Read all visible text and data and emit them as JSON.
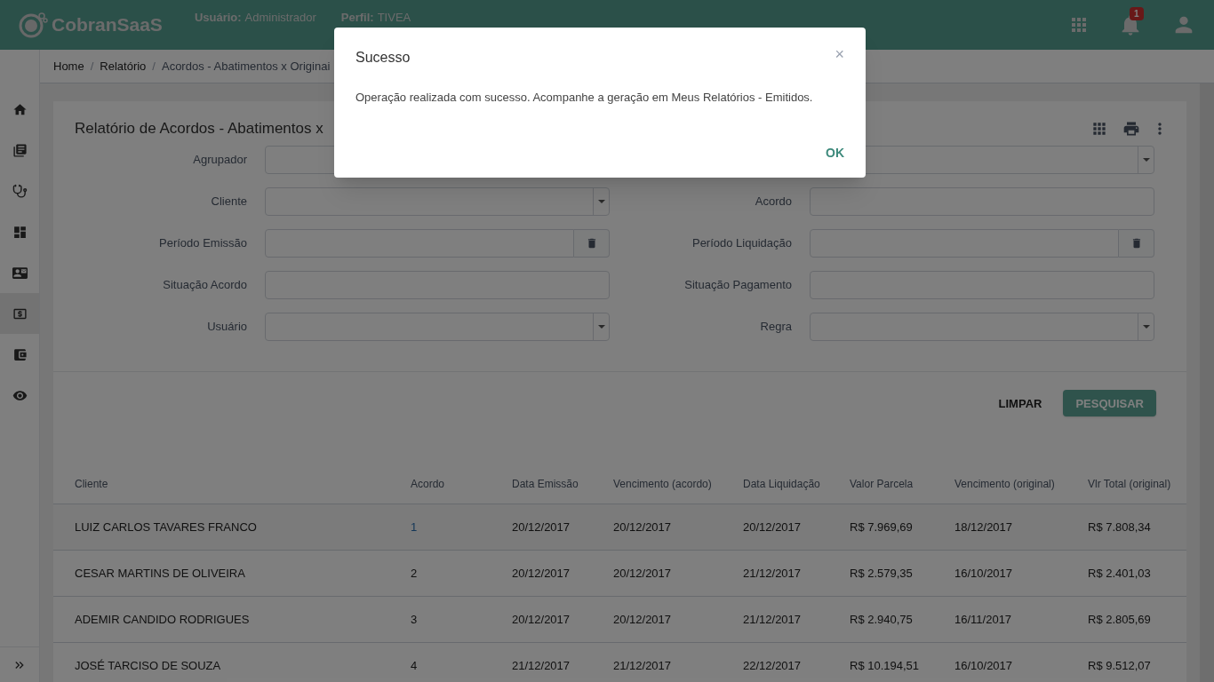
{
  "header": {
    "brand": "CobranSaaS",
    "user_label": "Usuário:",
    "user_value": "Administrador",
    "profile_label": "Perfil:",
    "profile_value": "TIVEA",
    "notification_count": "1"
  },
  "sidebar": {
    "items": [
      {
        "selected": false
      },
      {
        "selected": false
      },
      {
        "selected": false
      },
      {
        "selected": false
      },
      {
        "selected": false
      },
      {
        "selected": true
      },
      {
        "selected": false
      },
      {
        "selected": false
      }
    ]
  },
  "breadcrumb": {
    "separator": "/",
    "items": [
      "Home",
      "Relatório",
      "Acordos - Abatimentos x Originai"
    ]
  },
  "report": {
    "title": "Relatório de Acordos - Abatimentos x",
    "form_rows": [
      {
        "left": {
          "label": "Agrupador",
          "kind": "select"
        },
        "right": {
          "kind": "select"
        }
      },
      {
        "left": {
          "label": "Cliente",
          "kind": "select"
        },
        "right": {
          "label": "Acordo",
          "kind": "input"
        }
      },
      {
        "left": {
          "label": "Período Emissão",
          "kind": "date"
        },
        "right": {
          "label": "Período Liquidação",
          "kind": "date"
        }
      },
      {
        "left": {
          "label": "Situação Acordo",
          "kind": "input"
        },
        "right": {
          "label": "Situação Pagamento",
          "kind": "input"
        }
      },
      {
        "left": {
          "label": "Usuário",
          "kind": "select"
        },
        "right": {
          "label": "Regra",
          "kind": "select"
        }
      }
    ],
    "buttons": {
      "clear": "LIMPAR",
      "search": "PESQUISAR"
    },
    "table": {
      "columns": [
        "Cliente",
        "Acordo",
        "Data Emissão",
        "Vencimento (acordo)",
        "Data Liquidação",
        "Valor Parcela",
        "Vencimento (original)",
        "Vlr Total (original)"
      ],
      "rows": [
        {
          "cells": [
            "LUIZ CARLOS TAVARES FRANCO",
            "1",
            "20/12/2017",
            "20/12/2017",
            "20/12/2017",
            "R$ 7.969,69",
            "18/12/2017",
            "R$ 7.808,34"
          ],
          "hovered": true
        },
        {
          "cells": [
            "CESAR MARTINS DE OLIVEIRA",
            "2",
            "20/12/2017",
            "20/12/2017",
            "21/12/2017",
            "R$ 2.579,35",
            "16/10/2017",
            "R$ 2.401,03"
          ],
          "hovered": false
        },
        {
          "cells": [
            "ADEMIR CANDIDO RODRIGUES",
            "3",
            "20/12/2017",
            "20/12/2017",
            "21/12/2017",
            "R$ 2.940,75",
            "16/11/2017",
            "R$ 2.805,69"
          ],
          "hovered": false
        },
        {
          "cells": [
            "JOSÉ TARCISO DE SOUZA",
            "4",
            "21/12/2017",
            "21/12/2017",
            "22/12/2017",
            "R$ 10.194,51",
            "16/10/2017",
            "R$ 9.512,07"
          ],
          "hovered": false
        }
      ]
    }
  },
  "dialog": {
    "title": "Sucesso",
    "close": "×",
    "message": "Operação realizada com sucesso. Acompanhe a geração em Meus Relatórios - Emitidos.",
    "ok": "OK"
  }
}
